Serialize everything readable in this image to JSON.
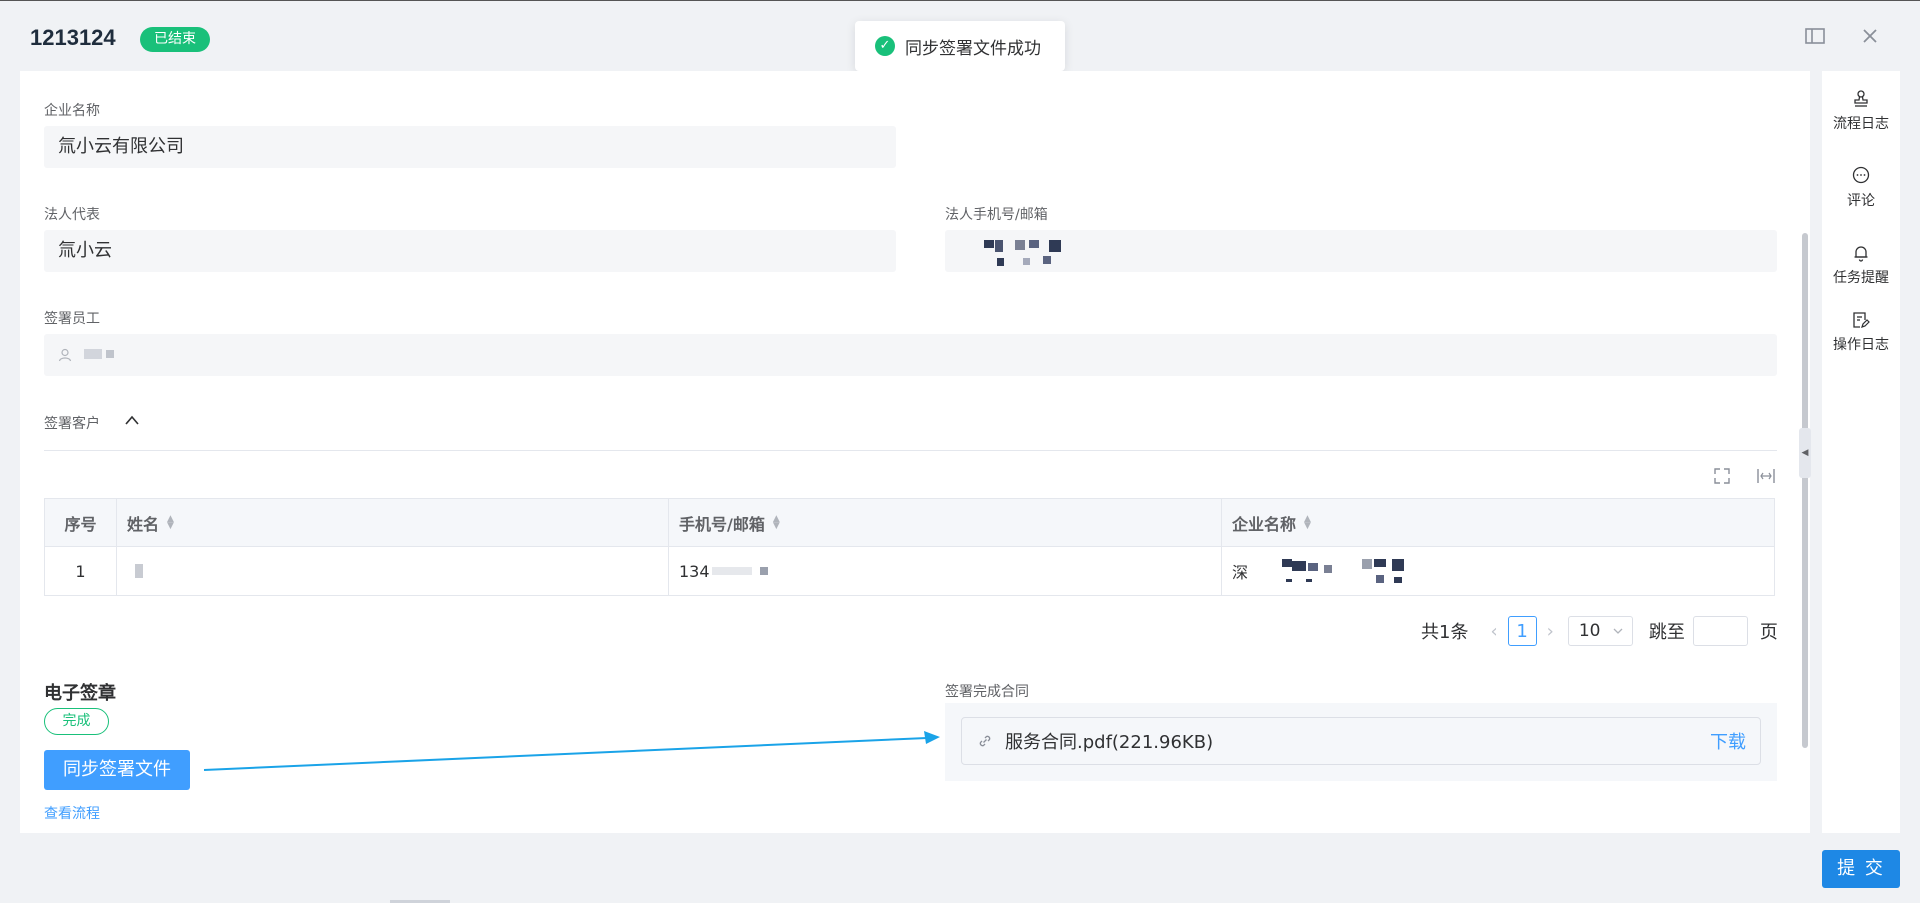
{
  "header": {
    "title": "1213124",
    "status": "已结束"
  },
  "toast": {
    "message": "同步签署文件成功"
  },
  "form": {
    "company_label": "企业名称",
    "company_value": "氚小云有限公司",
    "legal_rep_label": "法人代表",
    "legal_rep_value": "氚小云",
    "legal_phone_label": "法人手机号/邮箱",
    "employee_label": "签署员工",
    "customer_label": "签署客户"
  },
  "table": {
    "columns": [
      "序号",
      "姓名",
      "手机号/邮箱",
      "企业名称"
    ],
    "rows": [
      {
        "index": "1",
        "name": "",
        "phone": "134",
        "company": "深"
      }
    ]
  },
  "pagination": {
    "total": "共1条",
    "current": "1",
    "page_size": "10",
    "jump_label": "跳至",
    "page_unit": "页"
  },
  "esign": {
    "title": "电子签章",
    "status": "完成",
    "sync_button": "同步签署文件",
    "view_flow": "查看流程"
  },
  "contract": {
    "label": "签署完成合同",
    "file": "服务合同.pdf(221.96KB)",
    "download": "下载"
  },
  "sidebar": {
    "items": [
      {
        "label": "流程日志",
        "icon": "stamp-icon"
      },
      {
        "label": "评论",
        "icon": "comment-icon"
      },
      {
        "label": "任务提醒",
        "icon": "bell-icon"
      },
      {
        "label": "操作日志",
        "icon": "edit-log-icon"
      }
    ]
  },
  "footer": {
    "submit": "提 交"
  },
  "colors": {
    "primary": "#409eff",
    "success": "#19c07a",
    "submit": "#1e88e5"
  }
}
